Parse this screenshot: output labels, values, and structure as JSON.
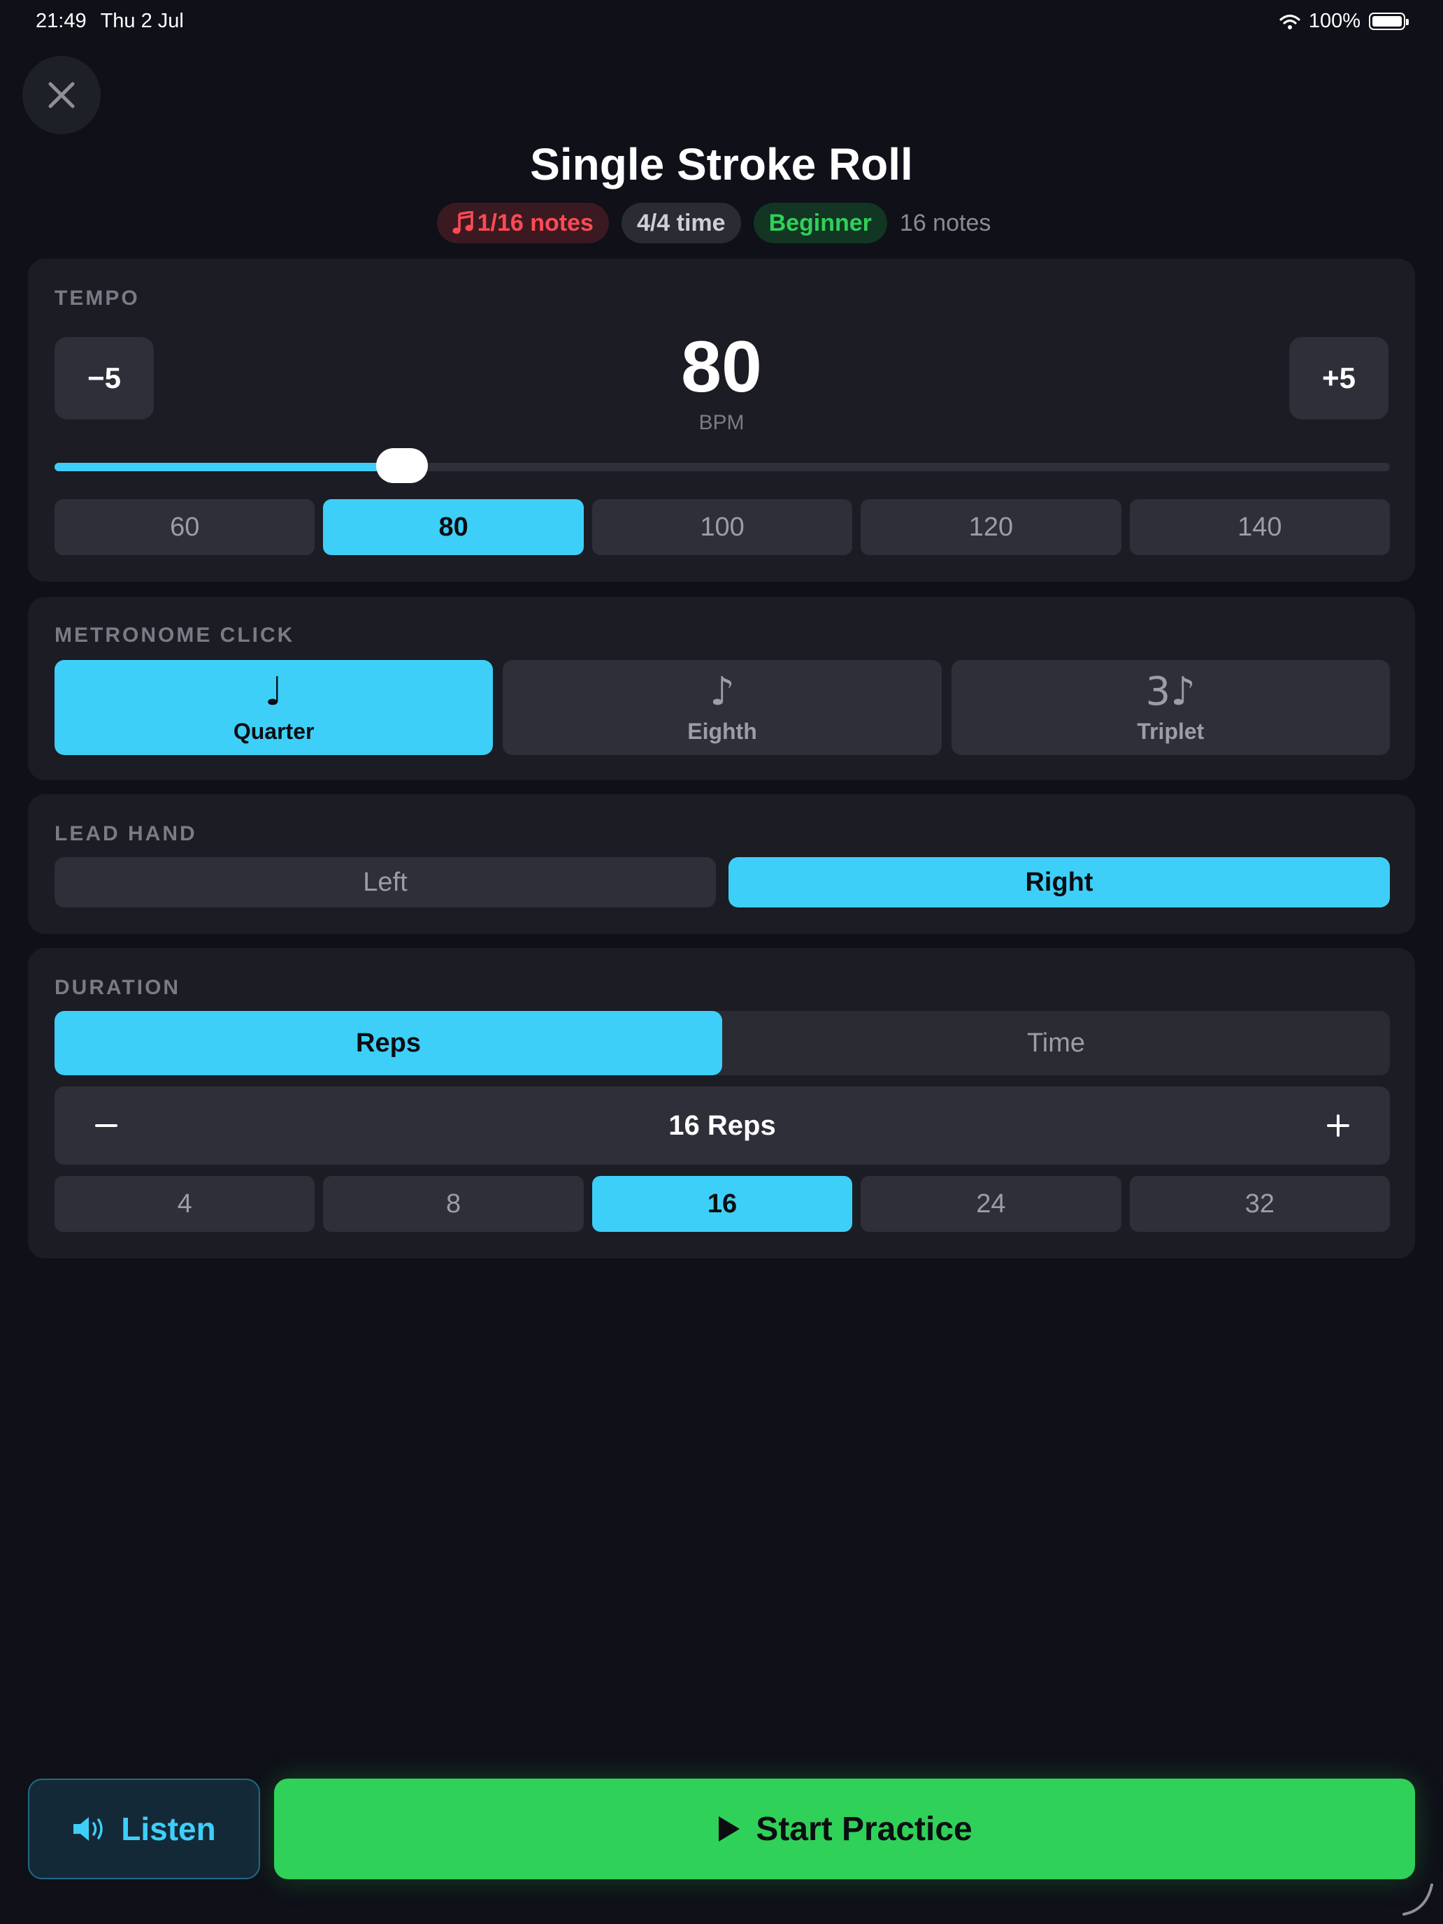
{
  "status": {
    "time": "21:49",
    "date": "Thu 2 Jul",
    "battery": "100%"
  },
  "exercise": {
    "title": "Single Stroke Roll",
    "note_value": "1/16 notes",
    "time_signature": "4/4 time",
    "level": "Beginner",
    "note_count": "16 notes"
  },
  "tempo": {
    "label": "TEMPO",
    "decrement": "−5",
    "increment": "+5",
    "value": "80",
    "unit": "BPM",
    "slider_fraction": 0.26,
    "presets": [
      "60",
      "80",
      "100",
      "120",
      "140"
    ],
    "selected_preset": "80"
  },
  "metronome": {
    "label": "METRONOME CLICK",
    "options": [
      {
        "icon": "♩",
        "label": "Quarter"
      },
      {
        "icon": "♪",
        "label": "Eighth"
      },
      {
        "icon": "3♪",
        "label": "Triplet"
      }
    ],
    "selected": "Quarter"
  },
  "lead_hand": {
    "label": "LEAD HAND",
    "options": [
      "Left",
      "Right"
    ],
    "selected": "Right"
  },
  "duration": {
    "label": "DURATION",
    "modes": [
      "Reps",
      "Time"
    ],
    "selected_mode": "Reps",
    "value": "16 Reps",
    "presets": [
      "4",
      "8",
      "16",
      "24",
      "32"
    ],
    "selected_preset": "16"
  },
  "actions": {
    "listen": "Listen",
    "start": "Start Practice"
  },
  "colors": {
    "accent": "#3dcff8",
    "go": "#2fd158",
    "background": "#0f1018",
    "card": "#1b1c24"
  }
}
